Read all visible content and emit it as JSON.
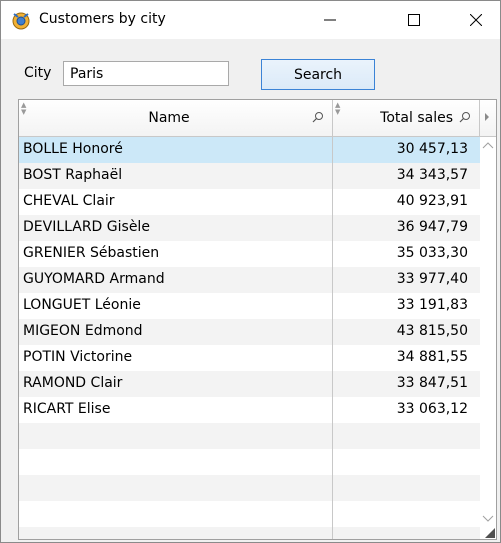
{
  "window": {
    "title": "Customers by city",
    "controls": {
      "minimize": "minimize-icon",
      "maximize": "maximize-icon",
      "close": "close-icon"
    }
  },
  "search": {
    "city_label": "City",
    "city_value": "Paris",
    "button_label": "Search"
  },
  "table": {
    "columns": [
      {
        "label": "Name"
      },
      {
        "label": "Total sales"
      }
    ],
    "rows": [
      {
        "name": "BOLLE Honoré",
        "total_sales": "30 457,13",
        "selected": true
      },
      {
        "name": "BOST Raphaël",
        "total_sales": "34 343,57"
      },
      {
        "name": "CHEVAL Clair",
        "total_sales": "40 923,91"
      },
      {
        "name": "DEVILLARD Gisèle",
        "total_sales": "36 947,79"
      },
      {
        "name": "GRENIER Sébastien",
        "total_sales": "35 033,30"
      },
      {
        "name": "GUYOMARD Armand",
        "total_sales": "33 977,40"
      },
      {
        "name": "LONGUET Léonie",
        "total_sales": "33 191,83"
      },
      {
        "name": "MIGEON Edmond",
        "total_sales": "43 815,50"
      },
      {
        "name": "POTIN Victorine",
        "total_sales": "34 881,55"
      },
      {
        "name": "RAMOND Clair",
        "total_sales": "33 847,51"
      },
      {
        "name": "RICART Elise",
        "total_sales": "33 063,12"
      }
    ]
  },
  "colors": {
    "selected_row": "#cce8f8",
    "alt_row": "#f3f3f3",
    "button_border": "#3b83d6"
  }
}
